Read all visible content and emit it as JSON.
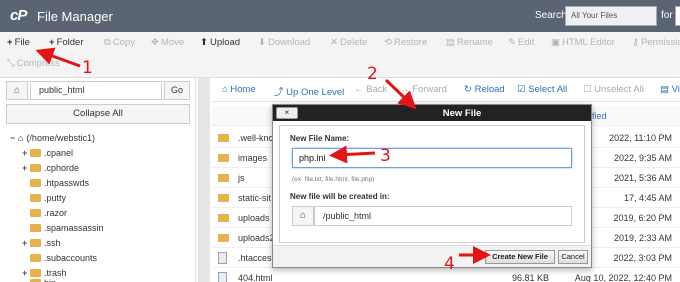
{
  "header": {
    "logo": "cP",
    "title": "File Manager",
    "search_label": "Search",
    "search_scope": "All Your Files",
    "search_for": "for"
  },
  "toolbar": {
    "row1": [
      {
        "icon": "plus-icon",
        "label": "File",
        "glyph": "+",
        "active": true
      },
      {
        "icon": "plus-icon",
        "label": "Folder",
        "glyph": "+",
        "active": true
      },
      {
        "icon": "copy-icon",
        "label": "Copy",
        "glyph": "⧉",
        "active": false
      },
      {
        "icon": "move-icon",
        "label": "Move",
        "glyph": "✥",
        "active": false
      },
      {
        "icon": "upload-icon",
        "label": "Upload",
        "glyph": "⬆",
        "active": true
      },
      {
        "icon": "download-icon",
        "label": "Download",
        "glyph": "⬇",
        "active": false
      },
      {
        "icon": "delete-icon",
        "label": "Delete",
        "glyph": "✕",
        "active": false
      },
      {
        "icon": "restore-icon",
        "label": "Restore",
        "glyph": "⟲",
        "active": false
      },
      {
        "icon": "rename-icon",
        "label": "Rename",
        "glyph": "▤",
        "active": false
      },
      {
        "icon": "edit-icon",
        "label": "Edit",
        "glyph": "✎",
        "active": false
      },
      {
        "icon": "html-editor-icon",
        "label": "HTML Editor",
        "glyph": "▣",
        "active": false
      },
      {
        "icon": "key-icon",
        "label": "Permissions",
        "glyph": "⚷",
        "active": false
      }
    ],
    "row2": [
      {
        "icon": "compress-icon",
        "label": "Compress",
        "glyph": "⤡",
        "active": false
      }
    ]
  },
  "left": {
    "path_value": "public_html",
    "go_label": "Go",
    "collapse_label": "Collapse All",
    "tree": [
      {
        "label": "(/home/webstic1)",
        "exp": "−",
        "indent": 0,
        "home": true
      },
      {
        "label": ".cpanel",
        "exp": "+",
        "indent": 1
      },
      {
        "label": ".cphorde",
        "exp": "+",
        "indent": 1
      },
      {
        "label": ".htpasswds",
        "exp": "",
        "indent": 1
      },
      {
        "label": ".putty",
        "exp": "",
        "indent": 1
      },
      {
        "label": ".razor",
        "exp": "",
        "indent": 1
      },
      {
        "label": ".spamassassin",
        "exp": "",
        "indent": 1
      },
      {
        "label": ".ssh",
        "exp": "+",
        "indent": 1
      },
      {
        "label": ".subaccounts",
        "exp": "",
        "indent": 1
      },
      {
        "label": ".trash",
        "exp": "+",
        "indent": 1
      },
      {
        "label": "bin",
        "exp": "",
        "indent": 1
      }
    ]
  },
  "right": {
    "nav": [
      {
        "icon": "home-icon",
        "glyph": "⌂",
        "label": "Home",
        "active": true
      },
      {
        "icon": "up-level-icon",
        "glyph": "⤴",
        "label": "Up One Level",
        "active": true
      },
      {
        "icon": "back-icon",
        "glyph": "←",
        "label": "Back",
        "active": false
      },
      {
        "icon": "forward-icon",
        "glyph": "→",
        "label": "Forward",
        "active": false
      },
      {
        "icon": "reload-icon",
        "glyph": "↻",
        "label": "Reload",
        "active": true
      },
      {
        "icon": "select-all-icon",
        "glyph": "☑",
        "label": "Select All",
        "active": true
      },
      {
        "icon": "unselect-all-icon",
        "glyph": "☐",
        "label": "Unselect All",
        "active": false
      },
      {
        "icon": "view-icon",
        "glyph": "▤",
        "label": "Vi",
        "active": true
      }
    ],
    "column_header_fragment": "fied",
    "rows": [
      {
        "type": "folder",
        "name": ".well-knc",
        "size": "",
        "date": "2022, 11:10 PM"
      },
      {
        "type": "folder",
        "name": "images",
        "size": "",
        "date": "2022, 9:35 AM"
      },
      {
        "type": "folder",
        "name": "js",
        "size": "",
        "date": "2021, 5:36 AM"
      },
      {
        "type": "folder",
        "name": "static-sit",
        "size": "",
        "date": "17, 4:45 AM"
      },
      {
        "type": "folder",
        "name": "uploads",
        "size": "",
        "date": "2019, 6:20 PM"
      },
      {
        "type": "folder",
        "name": "uploads2",
        "size": "",
        "date": "2019, 2:33 AM"
      },
      {
        "type": "file",
        "name": ".htacces",
        "size": "",
        "date": "2022, 3:03 PM"
      },
      {
        "type": "file",
        "name": "404.html",
        "size": "96.81 KB",
        "date": "Aug 10, 2022, 12:40 PM"
      }
    ]
  },
  "modal": {
    "title": "New File",
    "close_label": "×",
    "name_label": "New File Name:",
    "name_value": "php.ini",
    "hint": "(ex: file.txt, file.html, file.php)",
    "location_label": "New file will be created in:",
    "location_value": "/public_html",
    "create_label": "Create New File",
    "cancel_label": "Cancel"
  },
  "annotations": {
    "color": "#e21414",
    "labels": [
      "1",
      "2",
      "3",
      "4"
    ]
  }
}
